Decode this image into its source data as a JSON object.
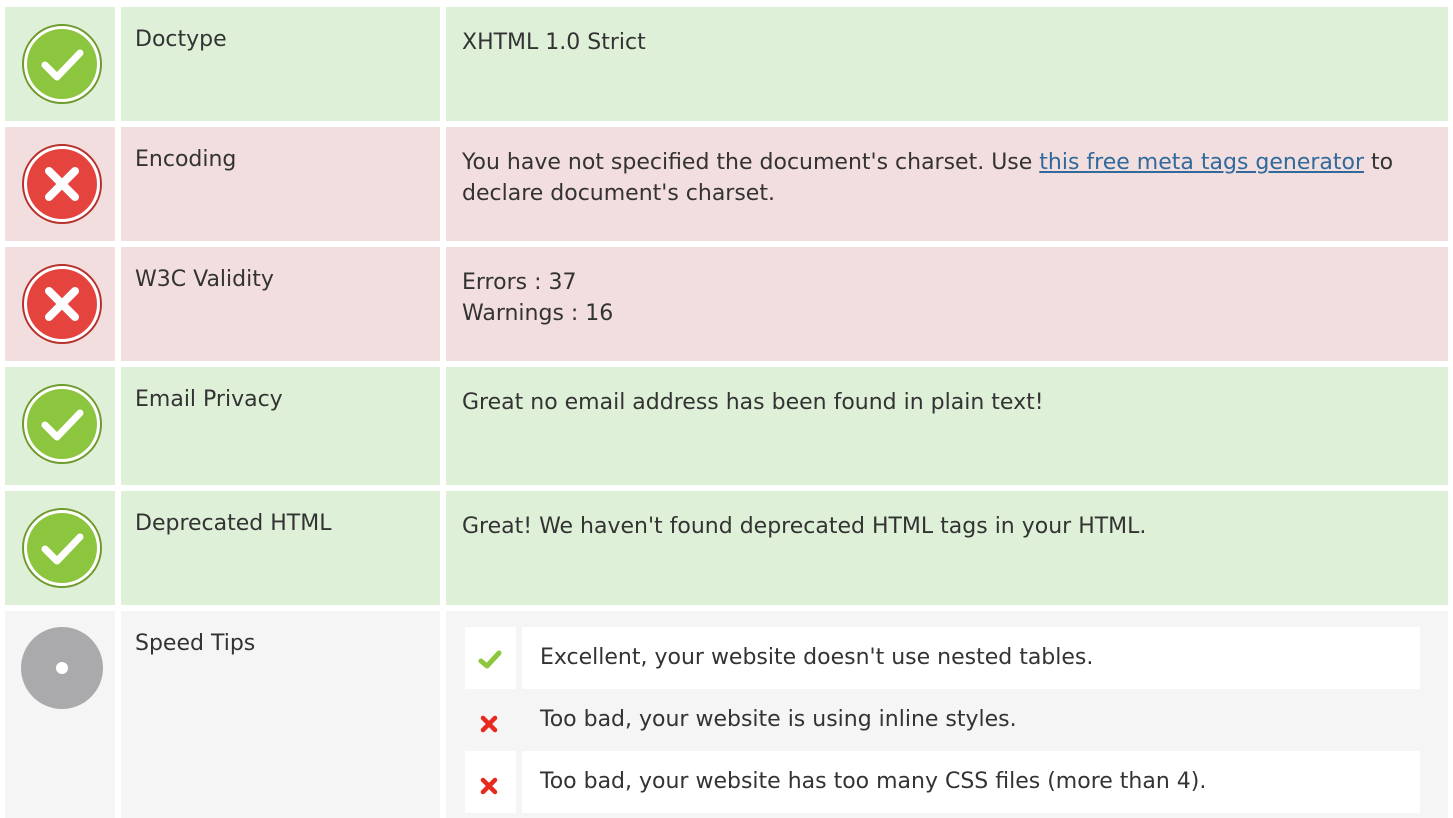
{
  "rows": [
    {
      "status": "pass",
      "label": "Doctype",
      "value": "XHTML 1.0 Strict"
    },
    {
      "status": "fail",
      "label": "Encoding",
      "value_before": "You have not specified the document's charset. Use ",
      "value_link": "this free meta tags generator",
      "value_after": " to declare document's charset."
    },
    {
      "status": "fail",
      "label": "W3C Validity",
      "value_line1": "Errors : 37",
      "value_line2": "Warnings : 16"
    },
    {
      "status": "pass",
      "label": "Email Privacy",
      "value": "Great no email address has been found in plain text!"
    },
    {
      "status": "pass",
      "label": "Deprecated HTML",
      "value": "Great! We haven't found deprecated HTML tags in your HTML."
    },
    {
      "status": "info",
      "label": "Speed Tips",
      "tips": [
        {
          "result": "pass",
          "icon": "check-icon",
          "text": "Excellent, your website doesn't use nested tables."
        },
        {
          "result": "fail",
          "icon": "cross-icon",
          "text": "Too bad, your website is using inline styles."
        },
        {
          "result": "fail",
          "icon": "cross-icon",
          "text": "Too bad, your website has too many CSS files (more than 4)."
        }
      ]
    }
  ],
  "colors": {
    "pass_bg": "#dff0d8",
    "fail_bg": "#f2dede",
    "neutral_bg": "#f5f5f5",
    "pass_icon": "#8cc63f",
    "fail_icon": "#e5433d",
    "info_icon": "#aaaaad",
    "link": "#30699c"
  }
}
